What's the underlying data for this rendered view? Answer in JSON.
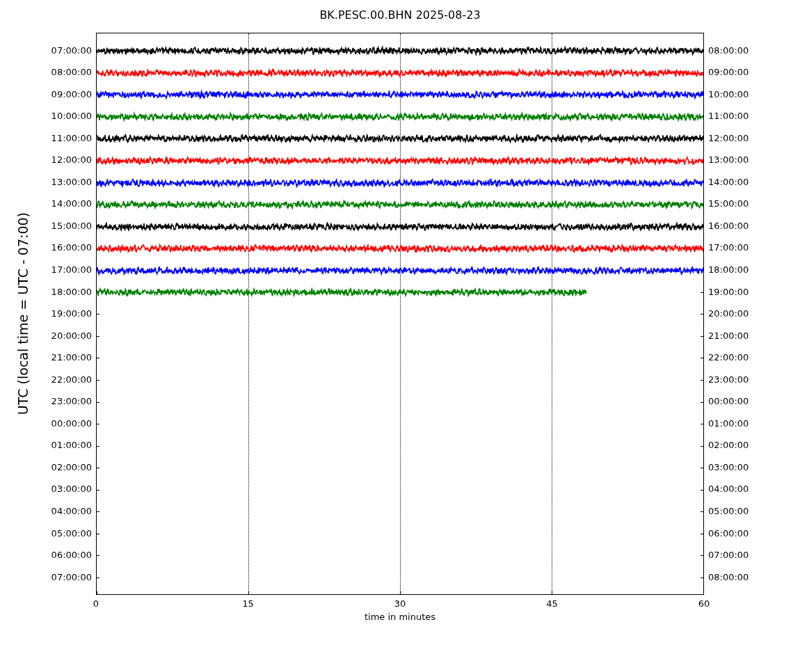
{
  "title": "BK.PESC.00.BHN 2025-08-23",
  "ylabel": "UTC (local time = UTC - 07:00)",
  "xlabel": "time in minutes",
  "xticks": [
    "0",
    "15",
    "30",
    "45",
    "60"
  ],
  "rows": [
    {
      "left": "07:00:00",
      "right": "08:00:00",
      "trace": {
        "color": "#000000",
        "level": 1
      }
    },
    {
      "left": "08:00:00",
      "right": "09:00:00",
      "trace": {
        "color": "#ff0000",
        "level": 1
      }
    },
    {
      "left": "09:00:00",
      "right": "10:00:00",
      "trace": {
        "color": "#0000ff",
        "level": 1
      }
    },
    {
      "left": "10:00:00",
      "right": "11:00:00",
      "trace": {
        "color": "#008000",
        "level": 1
      }
    },
    {
      "left": "11:00:00",
      "right": "12:00:00",
      "trace": {
        "color": "#000000",
        "level": 1
      }
    },
    {
      "left": "12:00:00",
      "right": "13:00:00",
      "trace": {
        "color": "#ff0000",
        "level": 1
      }
    },
    {
      "left": "13:00:00",
      "right": "14:00:00",
      "trace": {
        "color": "#0000ff",
        "level": 1
      }
    },
    {
      "left": "14:00:00",
      "right": "15:00:00",
      "trace": {
        "color": "#008000",
        "level": 1
      }
    },
    {
      "left": "15:00:00",
      "right": "16:00:00",
      "trace": {
        "color": "#000000",
        "level": 1
      }
    },
    {
      "left": "16:00:00",
      "right": "17:00:00",
      "trace": {
        "color": "#ff0000",
        "level": 1
      }
    },
    {
      "left": "17:00:00",
      "right": "18:00:00",
      "trace": {
        "color": "#0000ff",
        "level": 1
      }
    },
    {
      "left": "18:00:00",
      "right": "19:00:00",
      "trace": {
        "color": "#008000",
        "level": 0.805
      }
    },
    {
      "left": "19:00:00",
      "right": "20:00:00"
    },
    {
      "left": "20:00:00",
      "right": "21:00:00"
    },
    {
      "left": "21:00:00",
      "right": "22:00:00"
    },
    {
      "left": "22:00:00",
      "right": "23:00:00"
    },
    {
      "left": "23:00:00",
      "right": "00:00:00"
    },
    {
      "left": "00:00:00",
      "right": "01:00:00"
    },
    {
      "left": "01:00:00",
      "right": "02:00:00"
    },
    {
      "left": "02:00:00",
      "right": "03:00:00"
    },
    {
      "left": "03:00:00",
      "right": "04:00:00"
    },
    {
      "left": "04:00:00",
      "right": "05:00:00"
    },
    {
      "left": "05:00:00",
      "right": "06:00:00"
    },
    {
      "left": "06:00:00",
      "right": "07:00:00"
    },
    {
      "left": "07:00:00",
      "right": "08:00:00"
    }
  ]
}
